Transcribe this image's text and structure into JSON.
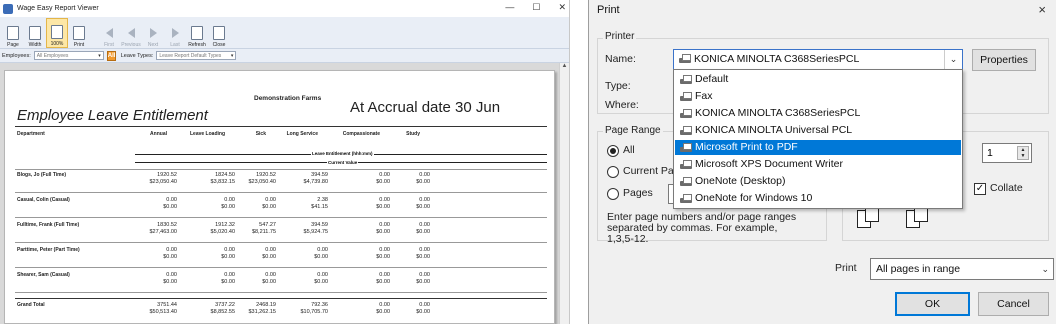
{
  "viewer": {
    "title": "Wage Easy Report Viewer",
    "toolbar": [
      {
        "label": "Page",
        "name": "page-button"
      },
      {
        "label": "Width",
        "name": "width-button"
      },
      {
        "label": "100%",
        "name": "zoom-100-button"
      },
      {
        "label": "Print",
        "name": "print-button"
      },
      {
        "label": "First",
        "name": "first-button"
      },
      {
        "label": "Previous",
        "name": "previous-button"
      },
      {
        "label": "Next",
        "name": "next-button"
      },
      {
        "label": "Last",
        "name": "last-button"
      },
      {
        "label": "Refresh",
        "name": "refresh-button"
      },
      {
        "label": "Close",
        "name": "close-button"
      }
    ],
    "filter": {
      "employees_label": "Employees:",
      "employees_value": "All Employees",
      "all_button": "All",
      "leave_types_label": "Leave Types:",
      "leave_types_value": "Leave Report Default Types"
    },
    "report": {
      "company": "Demonstration Farms",
      "title": "Employee Leave Entitlement",
      "accrual": "At Accrual date 30 Jun",
      "columns": [
        "Department",
        "Annual",
        "Leave Loading",
        "Sick",
        "Long Service",
        "Compassionate",
        "Study"
      ],
      "band_top": "Leave Entitlement (hhh:mm)",
      "band_bottom": "Current Value",
      "rows": [
        {
          "name": "Blogs, Jo (Full Time)",
          "hours": [
            "1920.52",
            "1824.50",
            "1920.52",
            "394.59",
            "0.00",
            "0.00"
          ],
          "values": [
            "$23,050.40",
            "$3,832.15",
            "$23,050.40",
            "$4,739.80",
            "$0.00",
            "$0.00"
          ]
        },
        {
          "name": "Casual, Colin (Casual)",
          "hours": [
            "0.00",
            "0.00",
            "0.00",
            "2.38",
            "0.00",
            "0.00"
          ],
          "values": [
            "$0.00",
            "$0.00",
            "$0.00",
            "$41.15",
            "$0.00",
            "$0.00"
          ]
        },
        {
          "name": "Fulltime, Frank (Full Time)",
          "hours": [
            "1830.52",
            "1912.32",
            "547.27",
            "394.59",
            "0.00",
            "0.00"
          ],
          "values": [
            "$27,463.00",
            "$5,020.40",
            "$8,211.75",
            "$5,924.75",
            "$0.00",
            "$0.00"
          ]
        },
        {
          "name": "Parttime, Peter (Part Time)",
          "hours": [
            "0.00",
            "0.00",
            "0.00",
            "0.00",
            "0.00",
            "0.00"
          ],
          "values": [
            "$0.00",
            "$0.00",
            "$0.00",
            "$0.00",
            "$0.00",
            "$0.00"
          ]
        },
        {
          "name": "Shearer, Sam (Casual)",
          "hours": [
            "0.00",
            "0.00",
            "0.00",
            "0.00",
            "0.00",
            "0.00"
          ],
          "values": [
            "$0.00",
            "$0.00",
            "$0.00",
            "$0.00",
            "$0.00",
            "$0.00"
          ]
        }
      ],
      "total": {
        "name": "Grand Total",
        "hours": [
          "3751.44",
          "3737.22",
          "2468.19",
          "792.36",
          "0.00",
          "0.00"
        ],
        "values": [
          "$50,513.40",
          "$8,852.55",
          "$31,262.15",
          "$10,705.70",
          "$0.00",
          "$0.00"
        ]
      }
    }
  },
  "dialog": {
    "title": "Print",
    "close": "×",
    "printer_group": "Printer",
    "name_label": "Name:",
    "selected_printer": "KONICA MINOLTA C368SeriesPCL",
    "properties_button": "Properties",
    "type_label": "Type:",
    "where_label": "Where:",
    "printers": [
      "Default",
      "Fax",
      "KONICA MINOLTA C368SeriesPCL",
      "KONICA MINOLTA Universal PCL",
      "Microsoft Print to PDF",
      "Microsoft XPS Document Writer",
      "OneNote (Desktop)",
      "OneNote for Windows 10"
    ],
    "highlighted_index": 4,
    "page_range_group": "Page Range",
    "radio_all": "All",
    "radio_current": "Current Pa",
    "radio_pages": "Pages",
    "pages_help": "Enter page numbers and/or page ranges separated by commas.  For example, 1,3,5-12.",
    "copies_value": "1",
    "collate_label": "Collate",
    "collate_checked": "✓",
    "print_label": "Print",
    "print_option": "All pages in range",
    "ok_button": "OK",
    "cancel_button": "Cancel"
  }
}
